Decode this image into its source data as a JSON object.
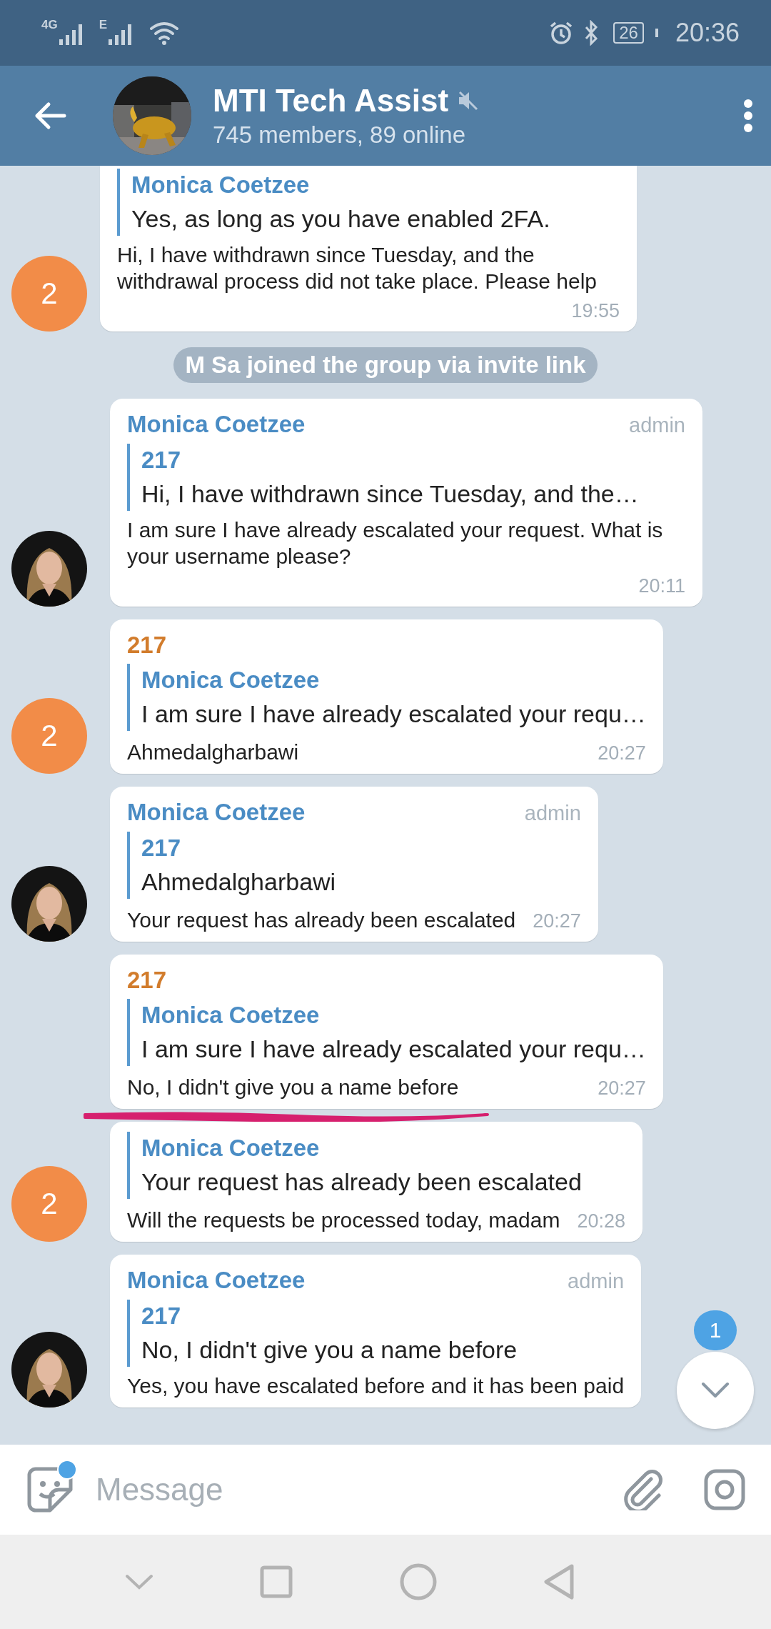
{
  "status_bar": {
    "network_1": "4G",
    "network_2": "E",
    "battery": "26",
    "time": "20:36"
  },
  "header": {
    "title": "MTI Tech Assist",
    "muted": true,
    "subtitle": "745 members, 89 online"
  },
  "messages": [
    {
      "kind": "message",
      "reply": {
        "name": "Monica Coetzee",
        "text": "Yes, as long as you have enabled 2FA."
      },
      "text": "Hi, I have withdrawn since Tuesday, and the withdrawal process did not take place. Please help",
      "time": "19:55",
      "avatar": {
        "kind": "initial",
        "initial": "2",
        "color": "#f28c48"
      },
      "underlined": false
    },
    {
      "kind": "service",
      "text": "M Sa joined the group via invite link"
    },
    {
      "kind": "message",
      "sender": "Monica Coetzee",
      "color": "#4a8cc4",
      "badge": "admin",
      "reply": {
        "name": "217",
        "text": "Hi, I have withdrawn since Tuesday, and the…"
      },
      "text": "I am sure I have already escalated your request. What is your username please?",
      "time": "20:11",
      "underlined": false
    },
    {
      "kind": "message",
      "sender": "217",
      "color": "#d27c2c",
      "reply": {
        "name": "Monica Coetzee",
        "text": "I am sure I have already escalated your requ…"
      },
      "text": "Ahmedalgharbawi",
      "time": "20:27",
      "avatar": {
        "kind": "initial",
        "initial": "2",
        "color": "#f28c48"
      },
      "underlined": false
    },
    {
      "kind": "message",
      "sender": "Monica Coetzee",
      "color": "#4a8cc4",
      "badge": "admin",
      "reply": {
        "name": "217",
        "text": "Ahmedalgharbawi"
      },
      "text": "Your request has already been escalated",
      "time": "20:27",
      "underlined": false
    },
    {
      "kind": "message",
      "sender": "217",
      "color": "#d27c2c",
      "reply": {
        "name": "Monica Coetzee",
        "text": "I am sure I have already escalated your requ…"
      },
      "text": "No, I didn't give you a name before",
      "time": "20:27",
      "underlined": true
    },
    {
      "kind": "message",
      "reply": {
        "name": "Monica Coetzee",
        "text": "Your request has already been escalated"
      },
      "text": "Will the requests be processed today, madam",
      "time": "20:28",
      "avatar": {
        "kind": "initial",
        "initial": "2",
        "color": "#f28c48"
      },
      "underlined": false
    },
    {
      "kind": "message",
      "sender": "Monica Coetzee",
      "color": "#4a8cc4",
      "badge": "admin",
      "reply": {
        "name": "217",
        "text": "No, I didn't give you a name before"
      },
      "text": "Yes, you have escalated before and it has been paid",
      "underlined": false
    }
  ],
  "scroll_button": {
    "badge": "1"
  },
  "composer": {
    "placeholder": "Message",
    "sticker_dot": true
  }
}
